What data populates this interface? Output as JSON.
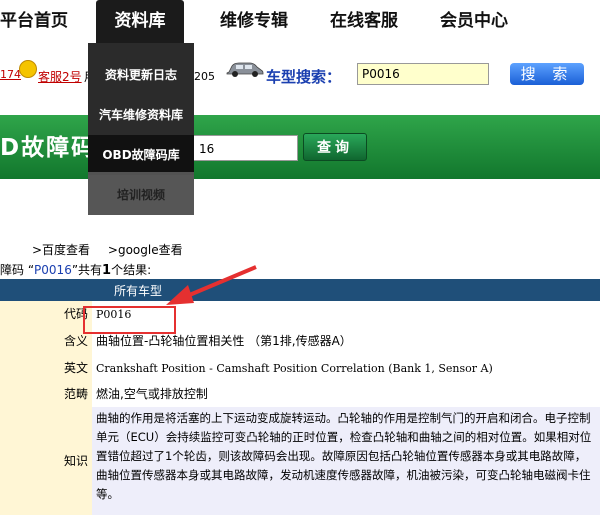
{
  "nav": {
    "items": [
      {
        "label": "平台首页"
      },
      {
        "label": "资料库"
      },
      {
        "label": "维修专辑"
      },
      {
        "label": "在线客服"
      },
      {
        "label": "会员中心"
      }
    ]
  },
  "service": {
    "left_num": "174",
    "cs2": "客服2号",
    "side_char": "用",
    "right_num": "205"
  },
  "car_search": {
    "label": "车型搜索：",
    "value": "P0016",
    "button": "搜 索"
  },
  "dropdown": {
    "items": [
      "资料更新日志",
      "汽车维修资料库",
      "OBD故障码库",
      "培训视频"
    ]
  },
  "obd": {
    "title": "D故障码",
    "input_value": "16",
    "button": "查询"
  },
  "links": {
    "baidu": ">百度查看",
    "google": ">google查看"
  },
  "result": {
    "prefix": "障码 “",
    "code": "P0016",
    "middle": "”共有",
    "count": "1",
    "suffix": "个结果:"
  },
  "table": {
    "header": "所有车型",
    "rows": {
      "code": {
        "label": "代码",
        "value": "P0016"
      },
      "meaning": {
        "label": "含义",
        "value": "曲轴位置-凸轮轴位置相关性 （第1排,传感器A）"
      },
      "english": {
        "label": "英文",
        "value": "Crankshaft Position - Camshaft Position Correlation (Bank 1, Sensor A)"
      },
      "scope": {
        "label": "范畴",
        "value": "燃油,空气或排放控制"
      },
      "knowledge": {
        "label": "知识",
        "value": "曲轴的作用是将活塞的上下运动变成旋转运动。凸轮轴的作用是控制气门的开启和闭合。电子控制单元（ECU）会持续监控可变凸轮轴的正时位置，检查凸轮轴和曲轴之间的相对位置。如果相对位置错位超过了1个轮齿，则该故障码会出现。故障原因包括凸轮轴位置传感器本身或其电路故障，曲轴位置传感器本身或其电路故障，发动机速度传感器故障，机油被污染，可变凸轮轴电磁阀卡住等。"
      }
    }
  },
  "colors": {
    "green_band": "#1f8f3c",
    "table_header": "#1f4f79",
    "label_bg": "#fff6d5",
    "knowledge_bg": "#eeeefa",
    "highlight": "#e53030"
  }
}
